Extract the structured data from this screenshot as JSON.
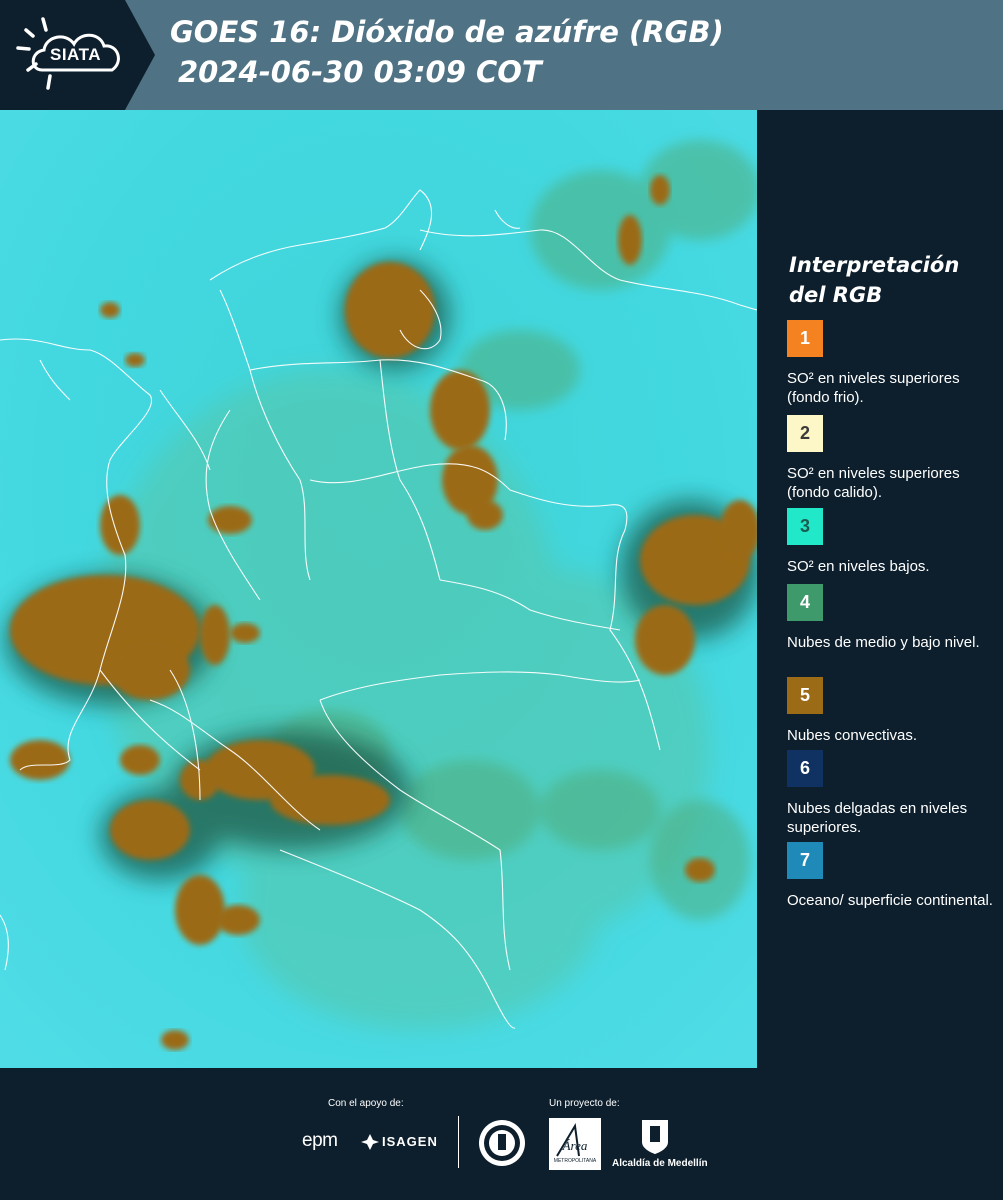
{
  "header": {
    "logo_text": "SIATA",
    "title": "GOES 16: Dióxido de azúfre (RGB)",
    "subtitle": "2024-06-30 03:09 COT"
  },
  "legend": {
    "title": "Interpretación del RGB",
    "items": [
      {
        "number": "1",
        "color": "#f58220",
        "number_color": "#ffffff",
        "description": "SO² en niveles superiores (fondo frio)."
      },
      {
        "number": "2",
        "color": "#fdf6c6",
        "number_color": "#3a3a3a",
        "description": "SO² en niveles superiores (fondo calido)."
      },
      {
        "number": "3",
        "color": "#20e8c8",
        "number_color": "#1a5d50",
        "description": "SO² en niveles bajos."
      },
      {
        "number": "4",
        "color": "#3f9a6b",
        "number_color": "#ffffff",
        "description": "Nubes de medio y bajo nivel."
      },
      {
        "number": "5",
        "color": "#9b6b16",
        "number_color": "#ffffff",
        "description": "Nubes convectivas."
      },
      {
        "number": "6",
        "color": "#0f3262",
        "number_color": "#ffffff",
        "description": "Nubes delgadas en niveles superiores."
      },
      {
        "number": "7",
        "color": "#1f8ab8",
        "number_color": "#ffffff",
        "description": "Oceano/ superficie continental."
      }
    ]
  },
  "footer": {
    "support_label": "Con el apoyo de:",
    "project_label": "Un proyecto de:",
    "brand_epm": "epm",
    "brand_isagen": "ISAGEN",
    "area_text": "Área",
    "area_sub": "METROPOLITANA",
    "alcaldia": "Alcaldía de Medellín"
  },
  "colors": {
    "header_bg": "#4f7384",
    "panel_bg": "#0d1f2c",
    "ocean": "#3ed6dc",
    "cloud_convective": "#9b6b16",
    "border": "#ffffff"
  }
}
